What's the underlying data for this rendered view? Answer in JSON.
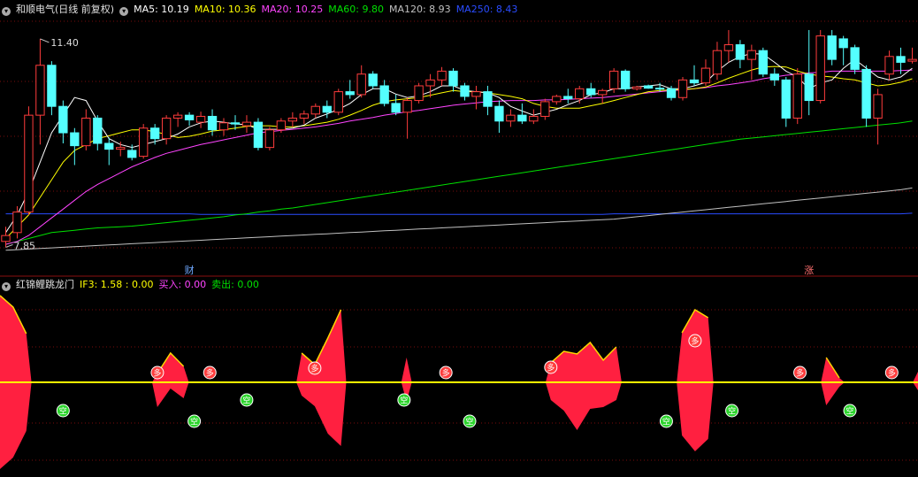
{
  "header_top": {
    "stock": "和顺电气(日线 前复权)",
    "ma5": "MA5: 10.19",
    "ma10": "MA10: 10.36",
    "ma20": "MA20: 10.25",
    "ma60": "MA60: 9.80",
    "ma120": "MA120: 8.93",
    "ma250": "MA250: 8.43"
  },
  "header_bottom": {
    "indicator": "红锦鲤跳龙门",
    "if3": "IF3: 1.58 : 0.00",
    "buy": "买入: 0.00",
    "sell": "卖出: 0.00"
  },
  "annotations": {
    "high": "11.40",
    "low": "7.85",
    "event_cai": "财",
    "event_zhang": "涨",
    "duo": "多",
    "kong": "空"
  },
  "colors": {
    "up": "#ff3c3c",
    "down": "#54ffff",
    "ma5": "#ffffff",
    "ma10": "#ffff00",
    "ma20": "#ff44ff",
    "ma60": "#00e000",
    "ma120": "#c0c0c0",
    "ma250": "#2a4cff",
    "fill": "#ff2040",
    "zero": "#ffff00",
    "duo": "#ff3c3c",
    "kong": "#2bd42b"
  },
  "chart_data": {
    "type": "candlestick",
    "price_range": [
      7.6,
      11.7
    ],
    "candles": [
      [
        7.95,
        8.2,
        7.85,
        8.05
      ],
      [
        8.1,
        8.55,
        8.0,
        8.45
      ],
      [
        8.45,
        10.25,
        8.4,
        10.1
      ],
      [
        10.1,
        11.4,
        9.6,
        10.95
      ],
      [
        10.95,
        11.02,
        10.1,
        10.25
      ],
      [
        10.25,
        10.35,
        9.62,
        9.8
      ],
      [
        9.8,
        9.88,
        9.25,
        9.58
      ],
      [
        9.58,
        10.2,
        9.5,
        10.05
      ],
      [
        10.05,
        10.1,
        9.5,
        9.62
      ],
      [
        9.62,
        9.72,
        9.25,
        9.52
      ],
      [
        9.52,
        9.65,
        9.4,
        9.55
      ],
      [
        9.5,
        9.6,
        9.33,
        9.38
      ],
      [
        9.4,
        9.95,
        9.36,
        9.88
      ],
      [
        9.88,
        9.95,
        9.6,
        9.7
      ],
      [
        9.7,
        10.1,
        9.6,
        10.05
      ],
      [
        10.05,
        10.15,
        9.9,
        10.1
      ],
      [
        10.1,
        10.15,
        9.92,
        10.02
      ],
      [
        9.98,
        10.16,
        9.88,
        10.08
      ],
      [
        10.08,
        10.2,
        9.75,
        9.85
      ],
      [
        9.85,
        10.05,
        9.75,
        9.97
      ],
      [
        9.97,
        10.1,
        9.85,
        9.95
      ],
      [
        9.92,
        10.1,
        9.8,
        9.98
      ],
      [
        9.98,
        10.05,
        9.5,
        9.55
      ],
      [
        9.55,
        9.9,
        9.5,
        9.85
      ],
      [
        9.85,
        10.05,
        9.8,
        10.0
      ],
      [
        10.0,
        10.15,
        9.9,
        10.05
      ],
      [
        10.05,
        10.18,
        9.95,
        10.12
      ],
      [
        10.12,
        10.3,
        10.05,
        10.25
      ],
      [
        10.25,
        10.35,
        10.05,
        10.15
      ],
      [
        10.15,
        10.55,
        10.1,
        10.5
      ],
      [
        10.5,
        10.7,
        10.38,
        10.45
      ],
      [
        10.45,
        10.95,
        10.4,
        10.8
      ],
      [
        10.8,
        10.85,
        10.55,
        10.6
      ],
      [
        10.6,
        10.7,
        10.25,
        10.3
      ],
      [
        10.3,
        10.45,
        10.1,
        10.15
      ],
      [
        10.15,
        10.4,
        9.7,
        10.35
      ],
      [
        10.35,
        10.65,
        10.3,
        10.6
      ],
      [
        10.6,
        10.8,
        10.4,
        10.7
      ],
      [
        10.7,
        10.92,
        10.6,
        10.85
      ],
      [
        10.85,
        10.9,
        10.5,
        10.6
      ],
      [
        10.6,
        10.65,
        10.35,
        10.42
      ],
      [
        10.42,
        10.6,
        10.2,
        10.5
      ],
      [
        10.5,
        10.6,
        10.1,
        10.25
      ],
      [
        10.25,
        10.35,
        9.8,
        10.0
      ],
      [
        10.0,
        10.2,
        9.9,
        10.1
      ],
      [
        10.1,
        10.3,
        9.95,
        10.0
      ],
      [
        10.0,
        10.2,
        9.95,
        10.08
      ],
      [
        10.08,
        10.38,
        10.02,
        10.33
      ],
      [
        10.33,
        10.45,
        10.28,
        10.42
      ],
      [
        10.42,
        10.55,
        10.3,
        10.38
      ],
      [
        10.38,
        10.6,
        10.3,
        10.55
      ],
      [
        10.55,
        10.65,
        10.4,
        10.45
      ],
      [
        10.45,
        10.55,
        10.3,
        10.52
      ],
      [
        10.55,
        10.9,
        10.48,
        10.85
      ],
      [
        10.85,
        10.88,
        10.5,
        10.55
      ],
      [
        10.55,
        10.6,
        10.52,
        10.58
      ],
      [
        10.6,
        10.62,
        10.55,
        10.56
      ],
      [
        10.56,
        10.65,
        10.5,
        10.55
      ],
      [
        10.55,
        10.6,
        10.35,
        10.4
      ],
      [
        10.4,
        10.75,
        10.35,
        10.7
      ],
      [
        10.7,
        10.95,
        10.6,
        10.65
      ],
      [
        10.65,
        11.05,
        10.6,
        10.9
      ],
      [
        10.8,
        11.35,
        10.7,
        11.2
      ],
      [
        11.2,
        11.55,
        11.0,
        11.3
      ],
      [
        11.3,
        11.38,
        10.9,
        11.05
      ],
      [
        11.05,
        11.3,
        10.7,
        11.2
      ],
      [
        11.2,
        11.25,
        10.75,
        10.8
      ],
      [
        10.8,
        10.9,
        10.6,
        10.7
      ],
      [
        10.7,
        10.75,
        9.9,
        10.05
      ],
      [
        10.05,
        10.9,
        9.95,
        10.8
      ],
      [
        10.8,
        11.55,
        10.1,
        10.35
      ],
      [
        10.35,
        11.55,
        10.3,
        11.45
      ],
      [
        11.45,
        11.55,
        10.95,
        11.05
      ],
      [
        11.4,
        11.45,
        10.95,
        11.25
      ],
      [
        11.25,
        11.3,
        10.8,
        10.88
      ],
      [
        10.88,
        10.95,
        9.9,
        10.05
      ],
      [
        10.05,
        10.55,
        9.6,
        10.45
      ],
      [
        10.8,
        11.2,
        10.7,
        11.1
      ],
      [
        11.1,
        11.25,
        10.8,
        11.0
      ],
      [
        11.02,
        11.25,
        10.98,
        11.05
      ]
    ],
    "ma5": [
      8.1,
      8.4,
      8.8,
      9.3,
      9.8,
      10.1,
      10.4,
      10.35,
      10.0,
      9.7,
      9.6,
      9.55,
      9.6,
      9.65,
      9.7,
      9.78,
      9.9,
      9.97,
      10.0,
      9.98,
      9.95,
      9.94,
      9.86,
      9.86,
      9.86,
      9.88,
      9.93,
      10.05,
      10.12,
      10.2,
      10.3,
      10.45,
      10.55,
      10.55,
      10.46,
      10.4,
      10.43,
      10.5,
      10.6,
      10.6,
      10.52,
      10.5,
      10.48,
      10.4,
      10.25,
      10.17,
      10.1,
      10.15,
      10.2,
      10.28,
      10.35,
      10.45,
      10.48,
      10.55,
      10.55,
      10.58,
      10.6,
      10.62,
      10.55,
      10.55,
      10.6,
      10.66,
      10.85,
      11.0,
      11.1,
      11.15,
      11.14,
      11.0,
      10.85,
      10.75,
      10.55,
      10.65,
      10.7,
      10.9,
      11.05,
      10.9,
      10.75,
      10.7,
      10.75,
      10.9
    ],
    "ma10": [
      8.0,
      8.2,
      8.4,
      8.7,
      9.0,
      9.3,
      9.5,
      9.6,
      9.7,
      9.75,
      9.8,
      9.85,
      9.85,
      9.82,
      9.77,
      9.72,
      9.74,
      9.78,
      9.83,
      9.85,
      9.88,
      9.91,
      9.92,
      9.92,
      9.9,
      9.9,
      9.92,
      9.95,
      9.98,
      10.03,
      10.1,
      10.18,
      10.27,
      10.33,
      10.36,
      10.38,
      10.4,
      10.44,
      10.48,
      10.52,
      10.5,
      10.5,
      10.48,
      10.45,
      10.42,
      10.38,
      10.3,
      10.25,
      10.22,
      10.22,
      10.22,
      10.26,
      10.3,
      10.35,
      10.4,
      10.45,
      10.5,
      10.52,
      10.53,
      10.54,
      10.55,
      10.58,
      10.65,
      10.73,
      10.8,
      10.87,
      10.92,
      10.93,
      10.92,
      10.85,
      10.8,
      10.77,
      10.75,
      10.72,
      10.7,
      10.65,
      10.6,
      10.62,
      10.66,
      10.72
    ],
    "ma20": [
      7.9,
      7.95,
      8.05,
      8.2,
      8.35,
      8.5,
      8.65,
      8.8,
      8.92,
      9.02,
      9.12,
      9.22,
      9.3,
      9.38,
      9.45,
      9.5,
      9.55,
      9.6,
      9.64,
      9.68,
      9.72,
      9.76,
      9.8,
      9.82,
      9.84,
      9.86,
      9.88,
      9.9,
      9.93,
      9.96,
      10.0,
      10.03,
      10.06,
      10.1,
      10.13,
      10.16,
      10.18,
      10.21,
      10.24,
      10.27,
      10.29,
      10.31,
      10.33,
      10.34,
      10.35,
      10.35,
      10.35,
      10.36,
      10.36,
      10.37,
      10.38,
      10.39,
      10.4,
      10.42,
      10.44,
      10.46,
      10.48,
      10.5,
      10.52,
      10.53,
      10.55,
      10.57,
      10.6,
      10.62,
      10.65,
      10.68,
      10.72,
      10.75,
      10.78,
      10.8,
      10.82,
      10.83,
      10.85,
      10.85,
      10.85,
      10.85,
      10.85,
      10.85,
      10.86,
      10.87
    ],
    "ma60": [
      7.9,
      7.95,
      8.0,
      8.05,
      8.1,
      8.12,
      8.14,
      8.16,
      8.18,
      8.19,
      8.2,
      8.21,
      8.23,
      8.25,
      8.27,
      8.29,
      8.31,
      8.33,
      8.35,
      8.37,
      8.4,
      8.42,
      8.45,
      8.47,
      8.5,
      8.52,
      8.55,
      8.58,
      8.61,
      8.64,
      8.67,
      8.7,
      8.73,
      8.76,
      8.79,
      8.82,
      8.85,
      8.88,
      8.91,
      8.94,
      8.97,
      9.0,
      9.03,
      9.06,
      9.09,
      9.12,
      9.15,
      9.18,
      9.21,
      9.24,
      9.27,
      9.3,
      9.33,
      9.36,
      9.39,
      9.42,
      9.45,
      9.48,
      9.51,
      9.54,
      9.57,
      9.6,
      9.63,
      9.66,
      9.69,
      9.71,
      9.73,
      9.75,
      9.77,
      9.79,
      9.81,
      9.83,
      9.85,
      9.87,
      9.89,
      9.91,
      9.93,
      9.95,
      9.97,
      10.0
    ],
    "ma120": [
      7.8,
      7.81,
      7.82,
      7.83,
      7.84,
      7.85,
      7.86,
      7.87,
      7.88,
      7.89,
      7.9,
      7.91,
      7.92,
      7.93,
      7.94,
      7.95,
      7.96,
      7.97,
      7.98,
      7.99,
      8.0,
      8.01,
      8.02,
      8.03,
      8.04,
      8.05,
      8.06,
      8.07,
      8.08,
      8.09,
      8.1,
      8.11,
      8.12,
      8.13,
      8.14,
      8.15,
      8.16,
      8.17,
      8.18,
      8.19,
      8.2,
      8.21,
      8.22,
      8.23,
      8.24,
      8.25,
      8.26,
      8.27,
      8.28,
      8.29,
      8.3,
      8.31,
      8.32,
      8.33,
      8.35,
      8.37,
      8.39,
      8.41,
      8.43,
      8.45,
      8.47,
      8.49,
      8.51,
      8.53,
      8.55,
      8.57,
      8.59,
      8.61,
      8.63,
      8.65,
      8.67,
      8.69,
      8.71,
      8.73,
      8.75,
      8.77,
      8.79,
      8.81,
      8.83,
      8.86
    ],
    "ma250": [
      8.42,
      8.42,
      8.42,
      8.42,
      8.42,
      8.42,
      8.42,
      8.42,
      8.42,
      8.42,
      8.42,
      8.42,
      8.42,
      8.42,
      8.42,
      8.42,
      8.42,
      8.41,
      8.41,
      8.41,
      8.41,
      8.41,
      8.41,
      8.41,
      8.41,
      8.41,
      8.41,
      8.41,
      8.41,
      8.41,
      8.41,
      8.41,
      8.41,
      8.41,
      8.41,
      8.41,
      8.41,
      8.41,
      8.41,
      8.41,
      8.41,
      8.41,
      8.41,
      8.41,
      8.41,
      8.41,
      8.41,
      8.41,
      8.41,
      8.41,
      8.41,
      8.41,
      8.41,
      8.42,
      8.42,
      8.42,
      8.42,
      8.42,
      8.42,
      8.42,
      8.42,
      8.42,
      8.42,
      8.42,
      8.42,
      8.42,
      8.42,
      8.42,
      8.42,
      8.42,
      8.42,
      8.42,
      8.42,
      8.42,
      8.42,
      8.42,
      8.42,
      8.42,
      8.42,
      8.43
    ],
    "event_cai_index": 16,
    "event_zhang_index": 70,
    "indicator": {
      "range": [
        -1.0,
        1.0
      ],
      "upper": [
        0.98,
        0.85,
        0.55,
        0.0,
        0,
        0,
        0,
        0,
        0,
        0,
        0,
        0,
        0.1,
        0.33,
        0.18,
        0,
        0,
        0,
        0,
        0,
        0,
        0,
        0,
        0.33,
        0.2,
        0.5,
        0.82,
        0,
        0,
        0,
        0,
        0.28,
        0,
        0,
        0,
        0,
        0,
        0,
        0,
        0,
        0,
        0,
        0.22,
        0.35,
        0.32,
        0.45,
        0.25,
        0.4,
        0,
        0,
        0,
        0,
        0.56,
        0.82,
        0.73,
        0,
        0,
        0,
        0,
        0,
        0,
        0,
        0,
        0.28,
        0.05,
        0,
        0,
        0,
        0,
        0,
        0.12
      ],
      "lower": [
        -0.98,
        -0.85,
        -0.55,
        0.0,
        0,
        0,
        0,
        0,
        0,
        0,
        0,
        0,
        -0.28,
        -0.07,
        -0.18,
        0,
        0,
        0,
        0,
        0,
        0,
        0,
        0,
        -0.15,
        -0.27,
        -0.58,
        -0.72,
        0,
        0,
        0,
        0,
        -0.22,
        0,
        0,
        0,
        0,
        0,
        0,
        0,
        0,
        0,
        0,
        -0.2,
        -0.32,
        -0.54,
        -0.3,
        -0.28,
        -0.2,
        0,
        0,
        0,
        0,
        -0.6,
        -0.78,
        -0.64,
        0,
        0,
        0,
        0,
        0,
        0,
        0,
        0,
        -0.26,
        -0.05,
        0,
        0,
        0,
        0,
        0,
        -0.09
      ],
      "duo_index": [
        12,
        16,
        24,
        34,
        42,
        53,
        61,
        68
      ],
      "kong_index": [
        4,
        14,
        18,
        30,
        35,
        50,
        55,
        64
      ]
    }
  }
}
